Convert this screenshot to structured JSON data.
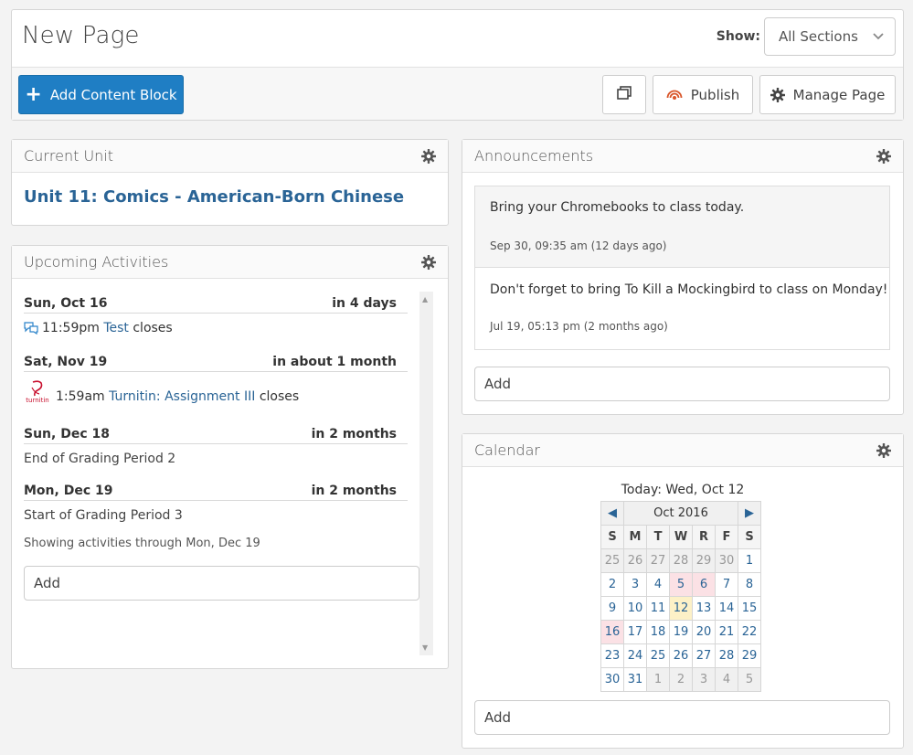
{
  "header": {
    "title": "New Page",
    "show_label": "Show:",
    "show_value": "All Sections",
    "add_content_label": "Add Content Block",
    "publish_label": "Publish",
    "manage_label": "Manage Page"
  },
  "current_unit": {
    "title": "Current Unit",
    "unit_link": "Unit 11: Comics - American-Born Chinese"
  },
  "upcoming": {
    "title": "Upcoming Activities",
    "groups": [
      {
        "date": "Sun, Oct 16",
        "rel": "in 4 days",
        "time": "11:59pm",
        "link": "Test",
        "suffix": "closes"
      },
      {
        "date": "Sat, Nov 19",
        "rel": "in about 1 month",
        "time": "1:59am",
        "link": "Turnitin: Assignment III",
        "suffix": "closes",
        "logo_text": "turnitin"
      },
      {
        "date": "Sun, Dec 18",
        "rel": "in 2 months",
        "text": "End of Grading Period 2"
      },
      {
        "date": "Mon, Dec 19",
        "rel": "in 2 months",
        "text": "Start of Grading Period 3"
      }
    ],
    "showing": "Showing activities through Mon, Dec 19",
    "add_placeholder": "Add"
  },
  "announcements": {
    "title": "Announcements",
    "items": [
      {
        "text": "Bring your Chromebooks to class today.",
        "time": "Sep 30, 09:35 am (12 days ago)"
      },
      {
        "text": "Don't forget to bring To Kill a Mockingbird to class on Monday!",
        "time": "Jul 19, 05:13 pm (2 months ago)"
      }
    ],
    "add_placeholder": "Add"
  },
  "calendar": {
    "title": "Calendar",
    "today_label": "Today: Wed, Oct 12",
    "month": "Oct 2016",
    "days_of_week": [
      "S",
      "M",
      "T",
      "W",
      "R",
      "F",
      "S"
    ],
    "weeks": [
      [
        "25",
        "26",
        "27",
        "28",
        "29",
        "30",
        "1"
      ],
      [
        "2",
        "3",
        "4",
        "5",
        "6",
        "7",
        "8"
      ],
      [
        "9",
        "10",
        "11",
        "12",
        "13",
        "14",
        "15"
      ],
      [
        "16",
        "17",
        "18",
        "19",
        "20",
        "21",
        "22"
      ],
      [
        "23",
        "24",
        "25",
        "26",
        "27",
        "28",
        "29"
      ],
      [
        "30",
        "31",
        "1",
        "2",
        "3",
        "4",
        "5"
      ]
    ],
    "add_placeholder": "Add"
  }
}
